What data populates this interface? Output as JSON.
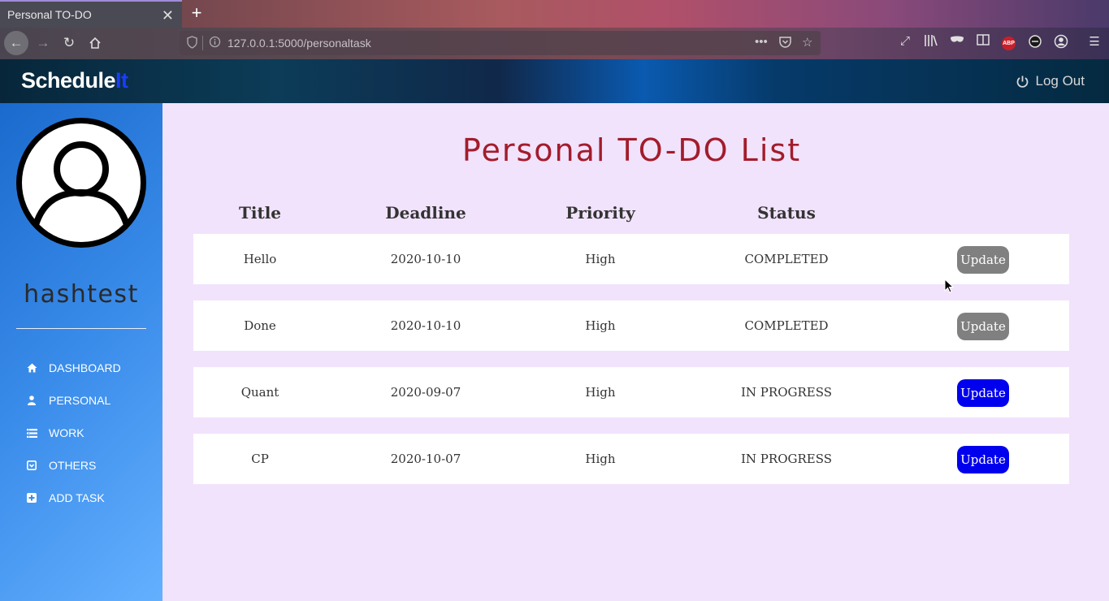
{
  "browser": {
    "tab_title": "Personal TO-DO",
    "url": "127.0.0.1:5000/personaltask"
  },
  "app": {
    "brand_part1": "Schedule",
    "brand_part2": "It",
    "logout_label": "Log Out"
  },
  "sidebar": {
    "username": "hashtest",
    "items": [
      {
        "label": "DASHBOARD",
        "icon": "home-icon"
      },
      {
        "label": "PERSONAL",
        "icon": "user-icon"
      },
      {
        "label": "WORK",
        "icon": "list-icon"
      },
      {
        "label": "OTHERS",
        "icon": "archive-icon"
      },
      {
        "label": "ADD TASK",
        "icon": "plus-square-icon"
      }
    ]
  },
  "main": {
    "title": "Personal TO-DO List",
    "columns": [
      "Title",
      "Deadline",
      "Priority",
      "Status"
    ],
    "rows": [
      {
        "title": "Hello",
        "deadline": "2020-10-10",
        "priority": "High",
        "status": "COMPLETED",
        "action": "Update"
      },
      {
        "title": "Done",
        "deadline": "2020-10-10",
        "priority": "High",
        "status": "COMPLETED",
        "action": "Update"
      },
      {
        "title": "Quant",
        "deadline": "2020-09-07",
        "priority": "High",
        "status": "IN PROGRESS",
        "action": "Update"
      },
      {
        "title": "CP",
        "deadline": "2020-10-07",
        "priority": "High",
        "status": "IN PROGRESS",
        "action": "Update"
      }
    ]
  },
  "colors": {
    "title": "#a31c2c",
    "page_bg": "#f1e3fc",
    "completed_button": "#808080",
    "in_progress_button": "#0000ee"
  }
}
